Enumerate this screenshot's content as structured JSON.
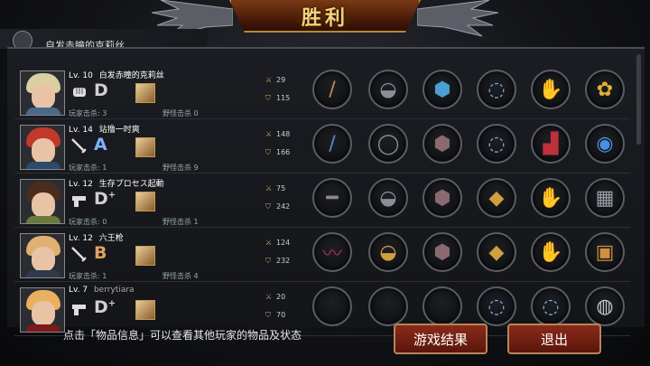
{
  "header": {
    "title": "胜利"
  },
  "peek_row": {
    "name": "自发赤瞳的克莉丝"
  },
  "players": [
    {
      "level": "Lv. 10",
      "name": "白发赤瞳的克莉丝",
      "grade": "D",
      "grade_plus": "",
      "grade_color": "#cfcfcf",
      "weapon_icon": "fist-icon",
      "kills_label": "玩家击杀: 3",
      "mobs_label": "野怪击杀 0",
      "attack": "29",
      "defense": "115",
      "items": [
        "spear",
        "helmet",
        "chest",
        "bracelet",
        "gloves",
        "ribbon"
      ],
      "hair": "#d9cfa0",
      "bodyc": "#4a6a8a"
    },
    {
      "level": "Lv. 14",
      "name": "站撸一时爽",
      "grade": "A",
      "grade_plus": "",
      "grade_color": "#7fb2ff",
      "weapon_icon": "blade-icon",
      "kills_label": "玩家击杀: 1",
      "mobs_label": "野怪击杀 9",
      "attack": "148",
      "defense": "166",
      "items": [
        "sword",
        "ring",
        "armor",
        "necklace",
        "boots",
        "gem-ring"
      ],
      "hair": "#c0392b",
      "bodyc": "#2c4a6a"
    },
    {
      "level": "Lv. 12",
      "name": "生存プロセス起動",
      "grade": "D",
      "grade_plus": "+",
      "grade_color": "#cfcfcf",
      "weapon_icon": "pistol-icon",
      "kills_label": "玩家击杀: 0",
      "mobs_label": "野怪击杀 1",
      "attack": "75",
      "defense": "242",
      "items": [
        "rifle",
        "helmet",
        "armor",
        "amulet",
        "gauntlet",
        "vest"
      ],
      "hair": "#4a2d1c",
      "bodyc": "#6a7a3a"
    },
    {
      "level": "Lv. 12",
      "name": "六王枪",
      "grade": "B",
      "grade_plus": "",
      "grade_color": "#e0a060",
      "weapon_icon": "blade-icon",
      "kills_label": "玩家击杀: 1",
      "mobs_label": "野怪击杀 4",
      "attack": "124",
      "defense": "232",
      "items": [
        "whip",
        "helmet-gold",
        "armor",
        "amulet",
        "gauntlet",
        "box"
      ],
      "hair": "#e0b070",
      "bodyc": "#2f3a4a"
    },
    {
      "level": "Lv. 7",
      "name": "berrytiara",
      "grade": "D",
      "grade_plus": "+",
      "grade_color": "#cfcfcf",
      "weapon_icon": "pistol-icon",
      "kills_label": "",
      "mobs_label": "",
      "attack": "20",
      "defense": "70",
      "items": [
        "empty",
        "empty",
        "empty",
        "necklace",
        "bracelet",
        "bracelet-silver"
      ],
      "hair": "#e8b060",
      "bodyc": "#7a1a1a"
    }
  ],
  "footer": {
    "hint": "点击「物品信息」可以查看其他玩家的物品及状态",
    "results_button": "游戏结果",
    "exit_button": "退出"
  }
}
